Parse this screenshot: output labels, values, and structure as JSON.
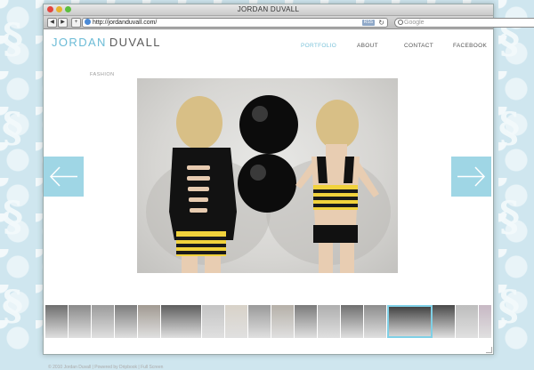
{
  "window": {
    "title": "JORDAN DUVALL",
    "url": "http://jordanduvall.com/",
    "rss_label": "RSS",
    "search_placeholder": "Google"
  },
  "toolbar": {
    "back_symbol": "◀",
    "forward_symbol": "▶",
    "add_symbol": "+",
    "reload_symbol": "↻"
  },
  "site": {
    "logo_first": "JORDAN",
    "logo_second": "DUVALL",
    "nav": [
      {
        "label": "PORTFOLIO",
        "active": true
      },
      {
        "label": "ABOUT",
        "active": false
      },
      {
        "label": "CONTACT",
        "active": false
      },
      {
        "label": "FACEBOOK",
        "active": false
      }
    ],
    "breadcrumb": "FASHION"
  },
  "gallery": {
    "main_photo": "photo-two-models-black-balloons",
    "prev_icon": "arrow-left-icon",
    "next_icon": "arrow-right-icon",
    "selected_thumbnail": 14,
    "thumbnails": [
      "#6e6e6e",
      "#8a8a8a",
      "#9b9b9b",
      "#7d7d7d",
      "#a19a92",
      "#5e5e5e",
      "#c4c4c4",
      "#d8d2c8",
      "#9a9a9a",
      "#b5b0a8",
      "#7b7b7b",
      "#aeaeae",
      "#6f6f6f",
      "#8d8d8d",
      "#3a3a3a",
      "#4a4a4a",
      "#bdbdbd",
      "#c7b8c4",
      "#a8a8a8"
    ]
  },
  "footer": {
    "text": "© 2010 Jordan Duvall | Powered by Dripbook | Full Screen"
  },
  "colors": {
    "accent": "#6bbbd6",
    "arrow_bg": "#9fd6e5",
    "background": "#cfe6ef"
  }
}
